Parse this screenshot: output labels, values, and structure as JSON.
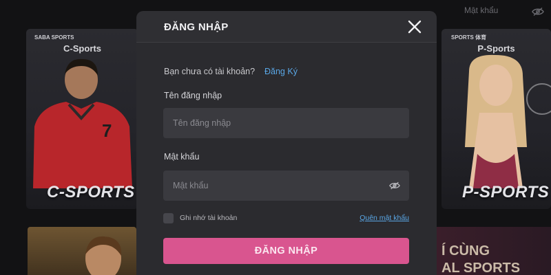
{
  "background": {
    "header": {
      "password_field_placeholder": "Mật khẩu",
      "eye_icon": "eye-off-icon"
    },
    "cards": [
      {
        "logo": "SABA SPORTS",
        "title": "C-Sports",
        "banner": "C-SPORTS"
      },
      {
        "logo": "SPORTS 体育",
        "title": "P-Sports",
        "banner": "P-SPORTS"
      }
    ],
    "promo": {
      "line1": "Í CÙNG",
      "line2": "AL SPORTS"
    }
  },
  "modal": {
    "title": "ĐĂNG NHẬP",
    "close_icon": "close-icon",
    "no_account_text": "Bạn chưa có tài khoản?",
    "register_link": "Đăng Ký",
    "username": {
      "label": "Tên đăng nhập",
      "placeholder": "Tên đăng nhập",
      "value": ""
    },
    "password": {
      "label": "Mật khẩu",
      "placeholder": "Mật khẩu",
      "value": "",
      "toggle_icon": "eye-off-icon"
    },
    "remember_label": "Ghi nhớ tài khoản",
    "remember_checked": false,
    "forgot_link": "Quên mật khẩu",
    "submit_label": "ĐĂNG NHẬP"
  },
  "colors": {
    "accent": "#d9558f",
    "link": "#5aa7e6",
    "modal_bg": "#2b2b2f",
    "input_bg": "#3a3a3f",
    "page_bg": "#121214"
  }
}
